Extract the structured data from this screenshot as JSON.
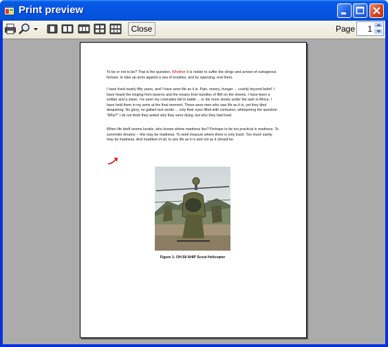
{
  "window": {
    "title": "Print preview"
  },
  "toolbar": {
    "close_label": "Close",
    "page_label": "Page",
    "page_value": "1",
    "icons": [
      "printer-icon",
      "zoom-icon",
      "chevron-down-icon",
      "one-page-icon",
      "two-pages-icon",
      "three-pages-icon",
      "four-pages-icon",
      "six-pages-icon"
    ]
  },
  "document": {
    "paragraphs": [
      {
        "before": "To be or not to be? That is the question. ",
        "highlight": "Whether",
        "after": " it is nobler to suffer the slings and arrows of outrageous fortune, to take up arms against a sea of troubles, and by opposing, end them."
      },
      {
        "text": "I have lived nearly fifty years, and I have seen life as it is. Pain, misery, hunger ... cruelty beyond belief. I have heard the singing from taverns and the moans from bundles of filth on the streets. I have been a soldier and a slave, I've seen my comrades fall in battle ... or die more slowly under the lash in Africa. I have held them in my arms at the final moment. These were men who saw life as it is, yet they died despairing. No glory, no gallant last words ... only their eyes filled with confusion, whimpering the question: \"Why?\" I do not think they asked why they were dying, but why they had lived."
      },
      {
        "text": "When life itself seems lunatic, who knows where madness lies? Perhaps to be too practical is madness. To surrender dreams -- this may be madness. To seek treasure where there is only trash. Too much sanity may be madness. And maddest of all, to see life as it is and not as it should be."
      }
    ],
    "figure_caption": "Figure 1:  OH-58 AHIP Scout Helicopter"
  },
  "colors": {
    "accent_red": "#d40000",
    "titlebar_blue": "#0554e3",
    "preview_bg": "#ababab"
  }
}
